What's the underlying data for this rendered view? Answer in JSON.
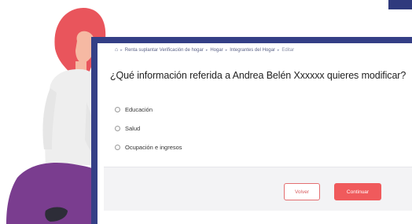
{
  "breadcrumb": {
    "items": [
      "Renta suplantar Verificación de hogar",
      "Hogar",
      "Integrantes del Hogar",
      "Editar"
    ]
  },
  "form": {
    "question": "¿Qué información referida a Andrea Belén Xxxxxx quieres modificar?",
    "options": [
      "Educación",
      "Salud",
      "Ocupación e ingresos"
    ]
  },
  "actions": {
    "back_label": "Volver",
    "continue_label": "Continuar"
  },
  "colors": {
    "frame": "#343f86",
    "accent": "#f05a5c",
    "hair": "#e9555c",
    "skin": "#f6b9a3",
    "pants": "#7a3d8f"
  },
  "icons": {
    "home": "home-icon",
    "separator": "chevron-right-icon"
  }
}
